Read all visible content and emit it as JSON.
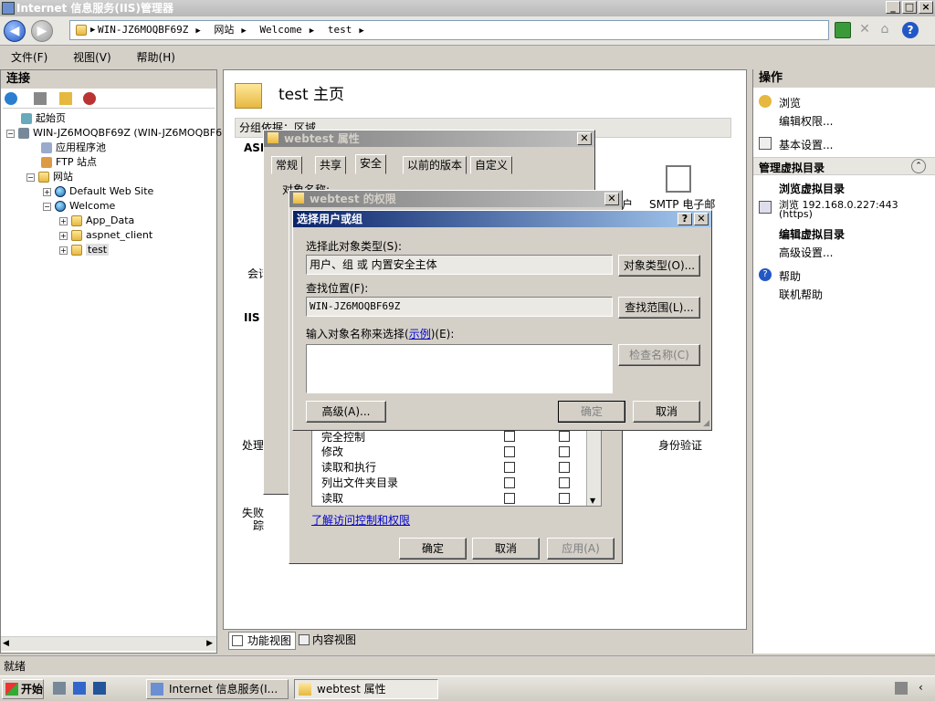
{
  "window": {
    "title": "Internet 信息服务(IIS)管理器"
  },
  "address": {
    "segments": [
      "WIN-JZ6MOQBF69Z",
      "网站",
      "Welcome",
      "test"
    ]
  },
  "menu": [
    "文件(F)",
    "视图(V)",
    "帮助(H)"
  ],
  "connections": {
    "header": "连接",
    "tree": [
      "起始页",
      "WIN-JZ6MOQBF69Z (WIN-JZ6MOQBF69Z",
      "应用程序池",
      "FTP 站点",
      "网站",
      "Default Web Site",
      "Welcome",
      "App_Data",
      "aspnet_client",
      "test"
    ]
  },
  "center": {
    "title": "test 主页",
    "groupby": "分组依据：区域",
    "section_asp": "ASP",
    "section_iis": "IIS",
    "features": [
      "SMTP 电子邮",
      "户",
      "身份验证",
      "处理",
      "会话",
      "失败",
      "踪"
    ],
    "bottom_tabs": [
      "功能视图",
      "内容视图"
    ]
  },
  "actions": {
    "header": "操作",
    "browse": "浏览",
    "edit_perms": "编辑权限...",
    "basic_settings": "基本设置...",
    "manage_vdir": "管理虚拟目录",
    "browse_vdir": "浏览虚拟目录",
    "browse_addr": "浏览 192.168.0.227:443",
    "https": "(https)",
    "edit_vdir": "编辑虚拟目录",
    "adv_settings": "高级设置...",
    "help": "帮助",
    "online_help": "联机帮助"
  },
  "status": "就绪",
  "taskbar": {
    "start": "开始",
    "items": [
      "Internet 信息服务(I...",
      "webtest 属性"
    ]
  },
  "props_dialog": {
    "title": "webtest 属性",
    "tabs": [
      "常规",
      "共享",
      "安全",
      "以前的版本",
      "自定义"
    ],
    "obj_label": "对象名称:"
  },
  "perm_dialog": {
    "title": "webtest 的权限",
    "rows": [
      "完全控制",
      "修改",
      "读取和执行",
      "列出文件夹目录",
      "读取"
    ],
    "link": "了解访问控制和权限",
    "ok": "确定",
    "cancel": "取消",
    "apply": "应用(A)"
  },
  "select_dialog": {
    "title": "选择用户或组",
    "obj_type_label": "选择此对象类型(S):",
    "obj_type_value": "用户、组 或 内置安全主体",
    "obj_type_btn": "对象类型(O)...",
    "location_label": "查找位置(F):",
    "location_value": "WIN-JZ6MOQBF69Z",
    "location_btn": "查找范围(L)...",
    "enter_label": "输入对象名称来选择(",
    "example": "示例",
    "enter_label2": ")(E):",
    "check_btn": "检查名称(C)",
    "advanced_btn": "高级(A)...",
    "ok": "确定",
    "cancel": "取消"
  }
}
